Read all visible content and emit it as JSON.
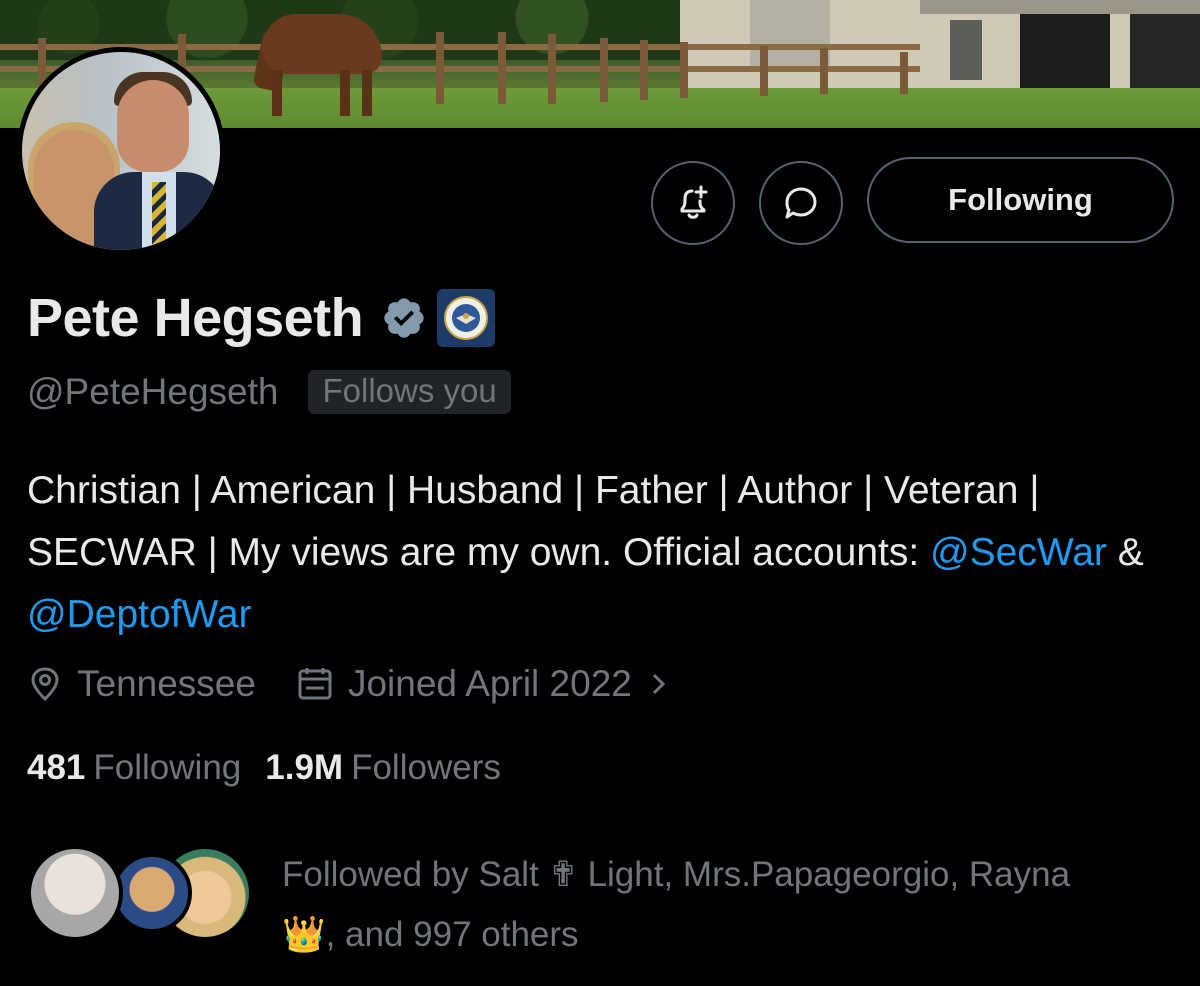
{
  "profile": {
    "name": "Pete Hegseth",
    "handle": "@PeteHegseth",
    "follows_you": "Follows you",
    "bio_text": "Christian | American | Husband | Father | Author | Veteran | SECWAR | My views are my own. Official accounts: ",
    "bio_mention_1": "@SecWar",
    "bio_amp": " & ",
    "bio_mention_2": "@DeptofWar",
    "location": "Tennessee",
    "joined": "Joined April 2022",
    "following_count": "481",
    "following_label": "Following",
    "followers_count": "1.9M",
    "followers_label": "Followers",
    "followed_by_line": "Followed by Salt ✟ Light, Mrs.Papageorgio, Rayna",
    "followed_by_emoji": "👑",
    "followed_by_rest": ", and 997 others"
  },
  "actions": {
    "follow_button_label": "Following",
    "notify_icon": "bell-plus-icon",
    "message_icon": "chat-bubble-icon"
  },
  "colors": {
    "background": "#000000",
    "text_primary": "#e7e9ea",
    "text_secondary": "#71767b",
    "accent": "#1d9bf0",
    "border": "#536471",
    "verified": "#829aab"
  }
}
